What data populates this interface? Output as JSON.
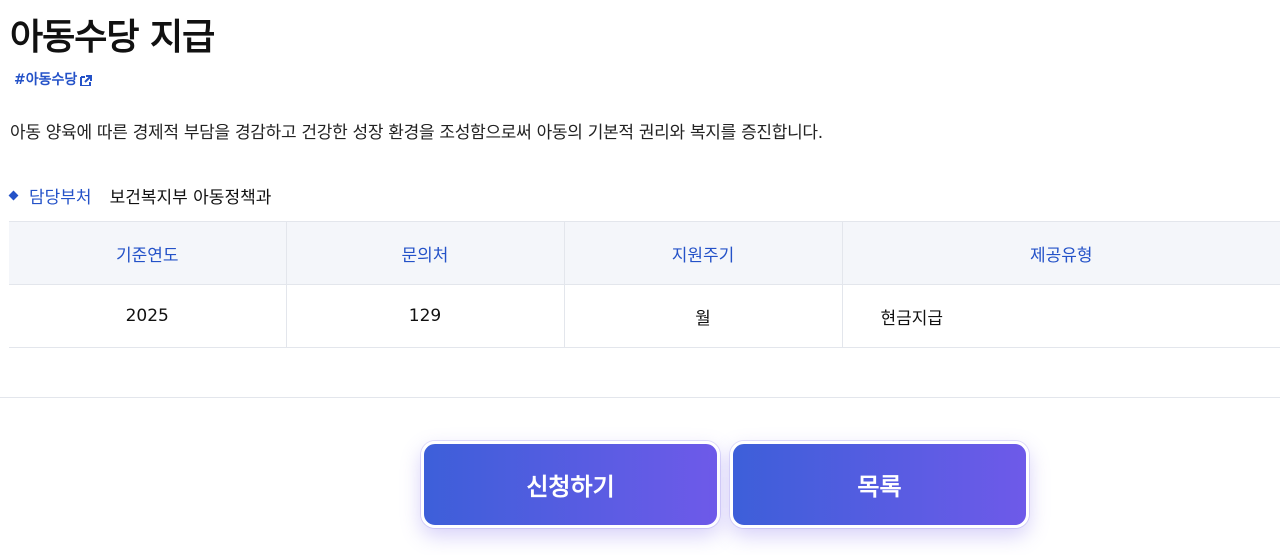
{
  "page": {
    "title": "아동수당 지급",
    "hashtag": "#아동수당",
    "description": "아동 양육에 따른 경제적 부담을 경감하고 건강한 성장 환경을 조성함으로써 아동의 기본적 권리와 복지를 증진합니다."
  },
  "department": {
    "label": "담당부처",
    "value": "보건복지부 아동정책과"
  },
  "info_table": {
    "headers": [
      "기준연도",
      "문의처",
      "지원주기",
      "제공유형"
    ],
    "row": [
      "2025",
      "129",
      "월",
      "현금지급"
    ]
  },
  "actions": {
    "apply_label": "신청하기",
    "list_label": "목록"
  },
  "colors": {
    "accent": "#2452c8",
    "button_start": "#3d5fd9",
    "button_end": "#6e5ae9"
  }
}
